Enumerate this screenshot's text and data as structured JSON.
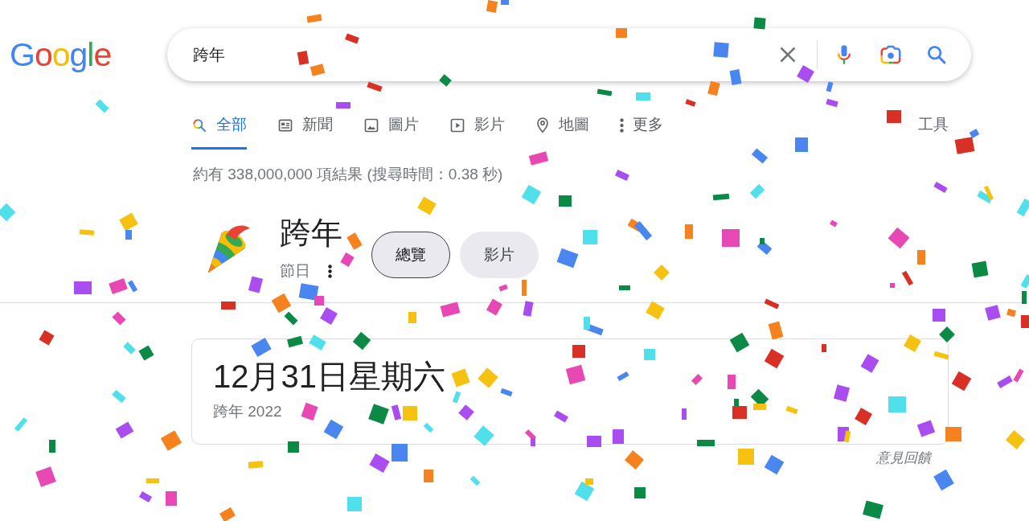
{
  "logo": {
    "text": "Google"
  },
  "search": {
    "value": "跨年"
  },
  "tabs": [
    {
      "kind": "all",
      "label": "全部",
      "selected": true
    },
    {
      "kind": "news",
      "label": "新聞",
      "selected": false
    },
    {
      "kind": "images",
      "label": "圖片",
      "selected": false
    },
    {
      "kind": "videos",
      "label": "影片",
      "selected": false
    },
    {
      "kind": "maps",
      "label": "地圖",
      "selected": false
    },
    {
      "kind": "more",
      "label": "更多",
      "selected": false
    }
  ],
  "tools": {
    "label": "工具"
  },
  "result_stats": "約有 338,000,000 項結果 (搜尋時間：0.38 秒)",
  "entity": {
    "title": "跨年",
    "subtitle": "節日",
    "chips": [
      {
        "label": "總覽",
        "selected": true
      },
      {
        "label": "影片",
        "selected": false
      }
    ]
  },
  "date_card": {
    "date": "12月31日星期六",
    "caption": "跨年 2022"
  },
  "feedback": {
    "label": "意見回饋"
  }
}
